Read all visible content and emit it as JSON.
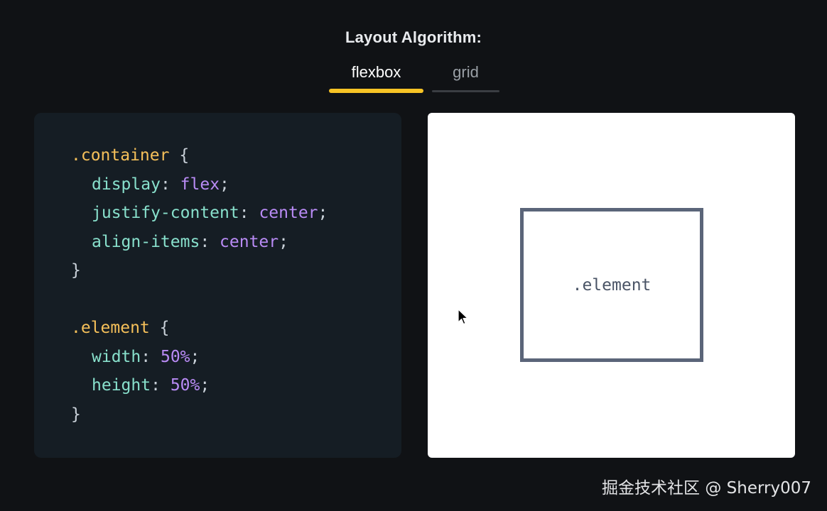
{
  "header": {
    "title": "Layout Algorithm:"
  },
  "tabs": [
    {
      "label": "flexbox",
      "selected": true
    },
    {
      "label": "grid",
      "selected": false
    }
  ],
  "code": {
    "container_selector": ".container",
    "container_rules": [
      {
        "prop": "display",
        "value": "flex"
      },
      {
        "prop": "justify-content",
        "value": "center"
      },
      {
        "prop": "align-items",
        "value": "center"
      }
    ],
    "element_selector": ".element",
    "element_rules": [
      {
        "prop": "width",
        "value": "50%"
      },
      {
        "prop": "height",
        "value": "50%"
      }
    ],
    "open_brace": "{",
    "close_brace": "}",
    "colon": ":",
    "semicolon": ";"
  },
  "preview": {
    "element_label": ".element"
  },
  "watermark": "掘金技术社区 @ Sherry007",
  "colors": {
    "background": "#101215",
    "accent": "#f7c325",
    "code_background": "#151d24",
    "selector": "#f5c05a",
    "property": "#88e0cc",
    "value": "#b98bf5",
    "element_border": "#5b6579"
  },
  "icons": {
    "cursor": "mouse-pointer-icon"
  }
}
